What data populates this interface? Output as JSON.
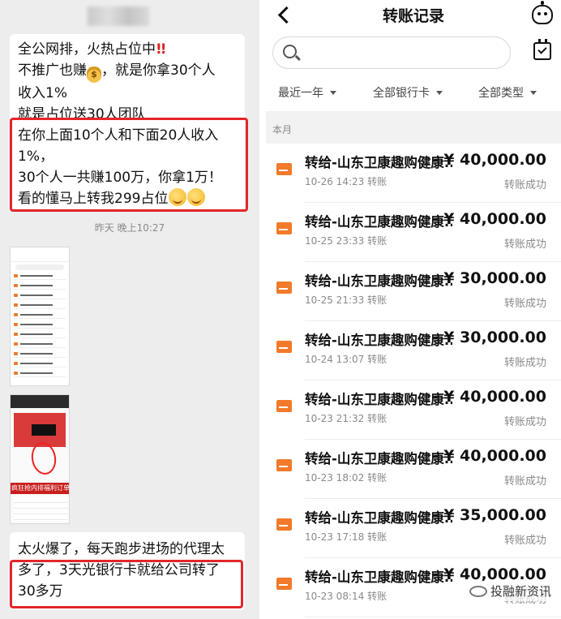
{
  "chat": {
    "message1_lines": [
      "全公网排，火热占位中",
      "不推广也赚",
      "，就是你拿30个人",
      "收入1%",
      "就是占位送30人团队",
      "在你上面10个人和下面20人收入",
      "1%，",
      "30个人一共赚100万，你拿1万！",
      "看的懂马上转我299占位"
    ],
    "bangs": "!!",
    "timestamp": "昨天 晚上10:27",
    "thumb2_caption": "疯狂抢内排福利订单",
    "message2_lines": [
      "太火爆了，每天跑步进场的代理太",
      "多了，3天光银行卡就给公司转了",
      "30多万"
    ]
  },
  "app": {
    "title": "转账记录",
    "search_placeholder": "",
    "filters": {
      "period": "最近一年",
      "card": "全部银行卡",
      "type": "全部类型"
    },
    "section": "本月",
    "records": [
      {
        "title": "转给-山东卫康趣购健康...",
        "amount": "- ¥ 40,000.00",
        "time": "10-26 14:23 转账",
        "status": "转账成功"
      },
      {
        "title": "转给-山东卫康趣购健康...",
        "amount": "- ¥ 40,000.00",
        "time": "10-25 23:33 转账",
        "status": "转账成功"
      },
      {
        "title": "转给-山东卫康趣购健康...",
        "amount": "- ¥ 30,000.00",
        "time": "10-25 21:33 转账",
        "status": "转账成功"
      },
      {
        "title": "转给-山东卫康趣购健康...",
        "amount": "- ¥ 30,000.00",
        "time": "10-24 13:07 转账",
        "status": "转账成功"
      },
      {
        "title": "转给-山东卫康趣购健康...",
        "amount": "- ¥ 40,000.00",
        "time": "10-23 21:32 转账",
        "status": "转账成功"
      },
      {
        "title": "转给-山东卫康趣购健康...",
        "amount": "- ¥ 40,000.00",
        "time": "10-23 18:02 转账",
        "status": "转账成功"
      },
      {
        "title": "转给-山东卫康趣购健康...",
        "amount": "- ¥ 35,000.00",
        "time": "10-23 17:18 转账",
        "status": "转账成功"
      },
      {
        "title": "转给-山东卫康趣购健康...",
        "amount": "- ¥ 40,000.00",
        "time": "10-23 08:14 转账",
        "status": "转账成功"
      }
    ],
    "watermark": "投融新资讯"
  },
  "colors": {
    "highlight_border": "#e3262a",
    "card_icon": "#f27a2a",
    "chat_background": "#ededed"
  }
}
